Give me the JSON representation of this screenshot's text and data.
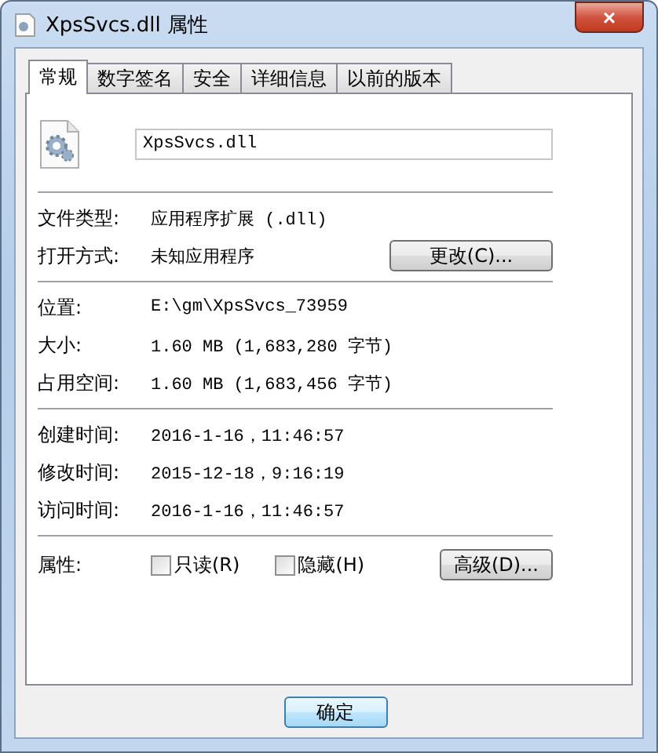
{
  "window": {
    "title": "XpsSvcs.dll 属性",
    "close": "×"
  },
  "tabs": [
    {
      "label": "常规",
      "selected": true
    },
    {
      "label": "数字签名",
      "selected": false
    },
    {
      "label": "安全",
      "selected": false
    },
    {
      "label": "详细信息",
      "selected": false
    },
    {
      "label": "以前的版本",
      "selected": false
    }
  ],
  "file_name": "XpsSvcs.dll",
  "groups": [
    [
      {
        "label": "文件类型:",
        "value": "应用程序扩展 (.dll)"
      },
      {
        "label": "打开方式:",
        "value": "未知应用程序",
        "button": "更改(C)..."
      }
    ],
    [
      {
        "label": "位置:",
        "value": "E:\\gm\\XpsSvcs_73959"
      },
      {
        "label": "大小:",
        "value": "1.60 MB (1,683,280 字节)"
      },
      {
        "label": "占用空间:",
        "value": "1.60 MB (1,683,456 字节)"
      }
    ],
    [
      {
        "label": "创建时间:",
        "value": "2016-1-16，11:46:57"
      },
      {
        "label": "修改时间:",
        "value": "2015-12-18，9:16:19"
      },
      {
        "label": "访问时间:",
        "value": "2016-1-16，11:46:57"
      }
    ]
  ],
  "attributes": {
    "label": "属性:",
    "checkboxes": [
      {
        "label": "只读(R)",
        "checked": false
      },
      {
        "label": "隐藏(H)",
        "checked": false
      }
    ],
    "button": "高级(D)..."
  },
  "buttons": [
    "确定"
  ]
}
